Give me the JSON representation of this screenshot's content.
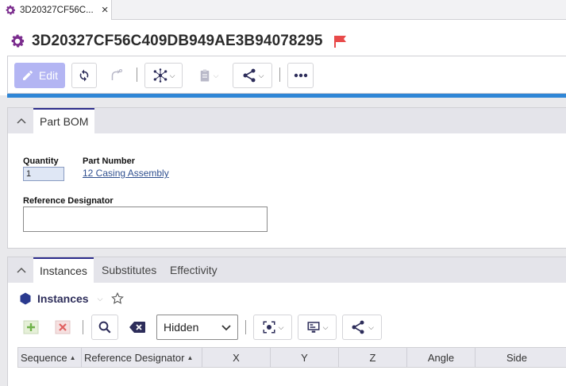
{
  "tab": {
    "title": "3D20327CF56C...",
    "close_glyph": "×",
    "icon": "gear-icon"
  },
  "header": {
    "title": "3D20327CF56C409DB949AE3B94078295",
    "icon": "gear-icon",
    "flag_icon": "flag-icon",
    "flag_color": "#e84a4a",
    "accent": "#7b2d8e"
  },
  "toolbar": {
    "edit_label": "Edit",
    "buttons": [
      "refresh-icon",
      "unclaim-icon",
      "network-icon",
      "clipboard-icon",
      "share-icon",
      "more-icon"
    ],
    "accent_color": "#2f86d6"
  },
  "part_bom_panel": {
    "tab_label": "Part BOM",
    "quantity_label": "Quantity",
    "quantity_value": "1",
    "part_number_label": "Part Number",
    "part_number_value": "12 Casing Assembly",
    "reference_designator_label": "Reference Designator",
    "reference_designator_value": ""
  },
  "instances_panel": {
    "tabs": [
      "Instances",
      "Substitutes",
      "Effectivity"
    ],
    "title": "Instances",
    "view_select_value": "Hidden",
    "columns": [
      "Sequence",
      "Reference Designator",
      "X",
      "Y",
      "Z",
      "Angle",
      "Side"
    ],
    "rows": []
  }
}
